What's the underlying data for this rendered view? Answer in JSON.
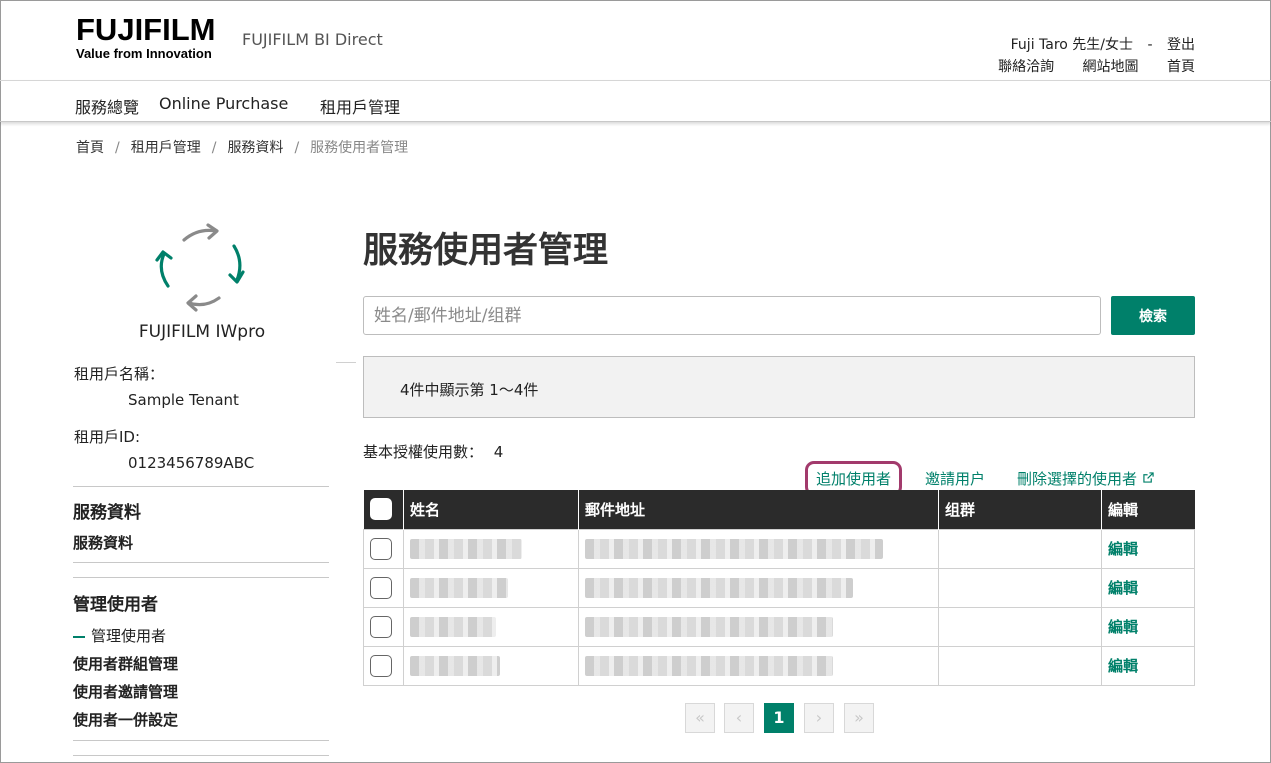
{
  "header": {
    "logo_text": "FUJIFILM",
    "logo_tagline": "Value from Innovation",
    "site_name": "FUJIFILM BI Direct",
    "user_name": "Fuji Taro 先生/女士",
    "user_sep": "-",
    "logout": "登出",
    "links": [
      "聯絡洽詢",
      "網站地圖",
      "首頁"
    ]
  },
  "nav": {
    "items": [
      "服務總覽",
      "Online Purchase",
      "租用戶管理"
    ]
  },
  "breadcrumb": {
    "items": [
      "首頁",
      "租用戶管理",
      "服務資料"
    ],
    "current": "服務使用者管理",
    "sep": "/"
  },
  "sidebar": {
    "product_name": "FUJIFILM IWpro",
    "tenant_name_label": "租用戶名稱：",
    "tenant_name": "Sample Tenant",
    "tenant_id_label": "租用戶ID:",
    "tenant_id": "0123456789ABC",
    "section1_title": "服務資料",
    "section1_link": "服務資料",
    "section2_title": "管理使用者",
    "section2_active": "管理使用者",
    "section2_links": [
      "使用者群組管理",
      "使用者邀請管理",
      "使用者一併設定"
    ]
  },
  "main": {
    "title": "服務使用者管理",
    "search_placeholder": "姓名/郵件地址/组群",
    "search_button": "檢索",
    "result_count": "4件中顯示第 1～4件",
    "license_label": "基本授權使用數：",
    "license_count": "4",
    "actions": {
      "add_user": "追加使用者",
      "invite_user": "邀請用户",
      "delete_selected": "刪除選擇的使用者"
    },
    "table": {
      "headers": [
        "姓名",
        "郵件地址",
        "组群",
        "編輯"
      ],
      "rows": [
        {
          "edit": "編輯"
        },
        {
          "edit": "編輯"
        },
        {
          "edit": "編輯"
        },
        {
          "edit": "編輯"
        }
      ]
    },
    "pagination": {
      "first": "«",
      "prev": "‹",
      "current": "1",
      "next": "›",
      "last": "»"
    }
  },
  "colors": {
    "accent": "#00806a",
    "highlight": "#a23a6c",
    "table_header": "#2b2b2b"
  },
  "icons": [
    "recycle-arrows-icon",
    "external-link-icon",
    "checkbox-icon"
  ]
}
